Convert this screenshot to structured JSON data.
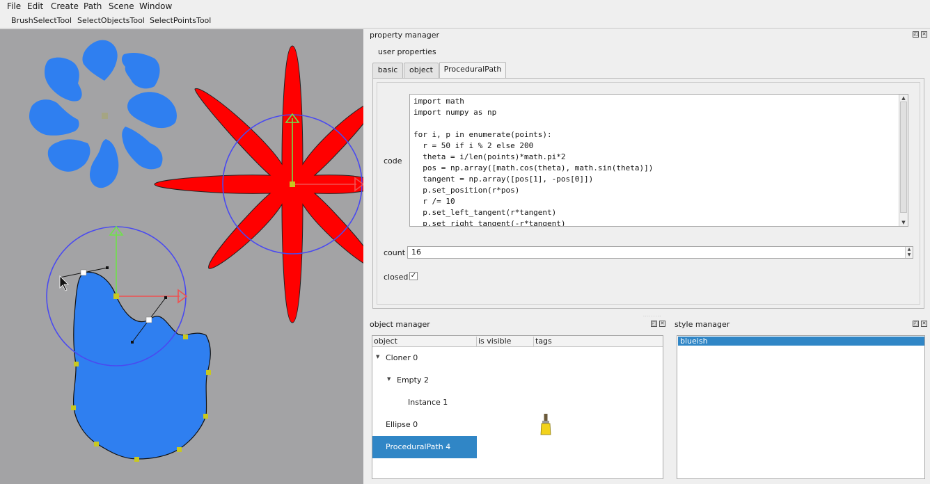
{
  "menubar": {
    "items": [
      {
        "label": "File"
      },
      {
        "label": "Edit"
      },
      {
        "label": "Create"
      },
      {
        "label": "Path"
      },
      {
        "label": "Scene"
      },
      {
        "label": "Window"
      }
    ]
  },
  "toolbar": {
    "tools": [
      {
        "label": "BrushSelectTool"
      },
      {
        "label": "SelectObjectsTool"
      },
      {
        "label": "SelectPointsTool"
      }
    ]
  },
  "property_manager": {
    "title": "property manager",
    "user_properties_label": "user properties",
    "tabs": [
      {
        "label": "basic",
        "active": false
      },
      {
        "label": "object",
        "active": false
      },
      {
        "label": "ProceduralPath",
        "active": true
      }
    ],
    "code_label": "code",
    "code": "import math\nimport numpy as np\n\nfor i, p in enumerate(points):\n  r = 50 if i % 2 else 200\n  theta = i/len(points)*math.pi*2\n  pos = np.array([math.cos(theta), math.sin(theta)])\n  tangent = np.array([pos[1], -pos[0]])\n  p.set_position(r*pos)\n  r /= 10\n  p.set_left_tangent(r*tangent)\n  p.set_right_tangent(-r*tangent)",
    "count_label": "count",
    "count_value": "16",
    "closed_label": "closed",
    "closed_checked": true,
    "closed_mark": "✓"
  },
  "object_manager": {
    "title": "object manager",
    "columns": [
      "object",
      "is visible",
      "tags"
    ],
    "rows": [
      {
        "label": "Cloner 0",
        "expanded": true
      },
      {
        "label": "Empty 2",
        "expanded": true
      },
      {
        "label": "Instance 1"
      },
      {
        "label": "Ellipse 0",
        "tag_icon": "paintbrush-icon"
      },
      {
        "label": "ProceduralPath 4",
        "selected": true
      }
    ]
  },
  "style_manager": {
    "title": "style manager",
    "items": [
      {
        "label": "blueish",
        "selected": true
      }
    ]
  },
  "colors": {
    "viewport_bg": "#a3a3a5",
    "blob_fill": "#2f7ff0",
    "star_fill": "#ff0000",
    "selection": "#3086c6",
    "gizmo_circle": "#4a4af0",
    "gizmo_y": "#6fe24a",
    "gizmo_x": "#f05050",
    "control_point": "#c8c820"
  }
}
